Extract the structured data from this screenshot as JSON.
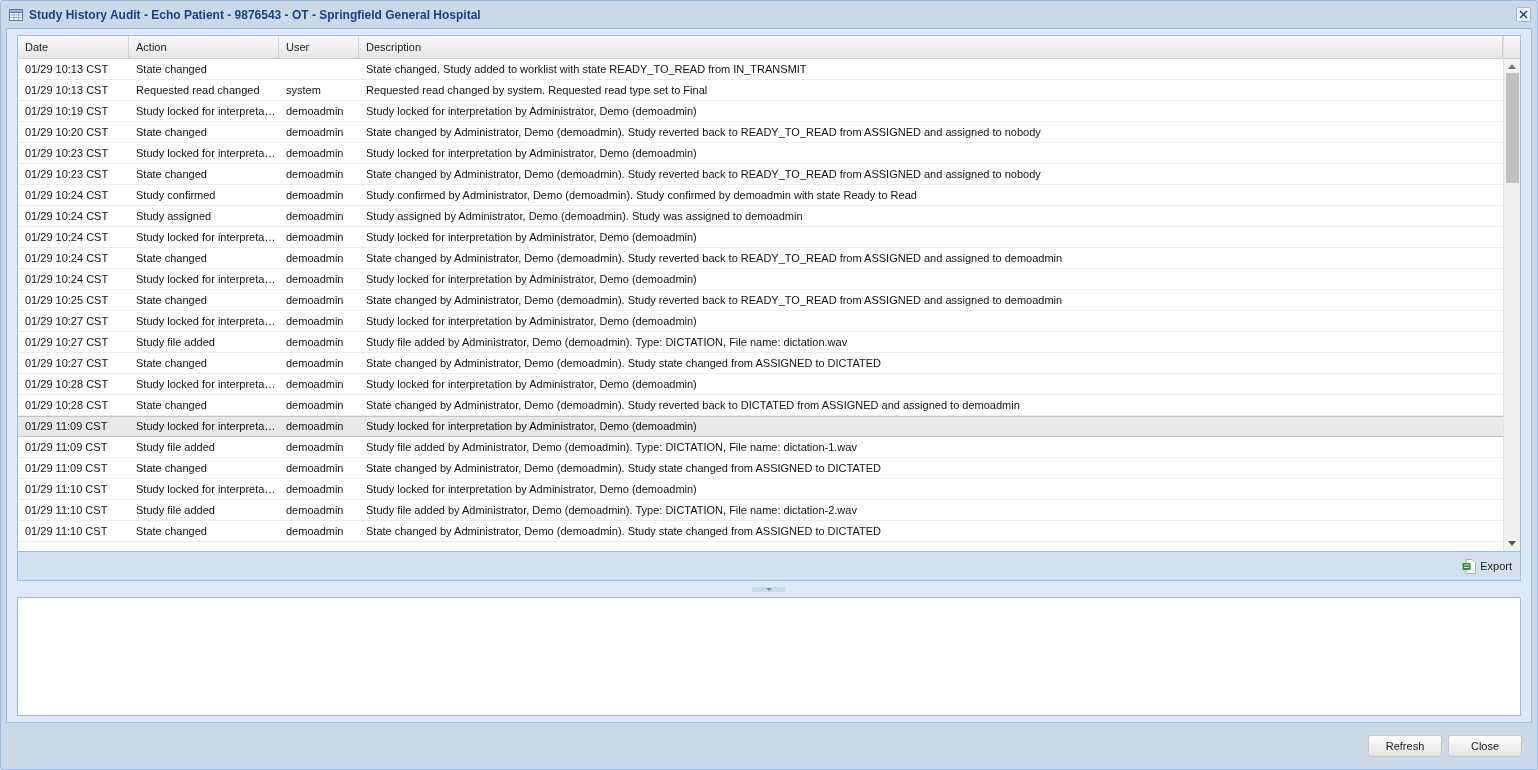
{
  "window": {
    "title": "Study History Audit - Echo Patient - 9876543 - OT - Springfield General Hospital"
  },
  "table": {
    "columns": [
      "Date",
      "Action",
      "User",
      "Description"
    ],
    "rows": [
      {
        "cells": [
          "01/29 10:13 CST",
          "State changed",
          "",
          "State changed. Study added to worklist with state READY_TO_READ from IN_TRANSMIT"
        ],
        "selected": false
      },
      {
        "cells": [
          "01/29 10:13 CST",
          "Requested read changed",
          "system",
          "Requested read changed by system. Requested read type set to Final"
        ],
        "selected": false
      },
      {
        "cells": [
          "01/29 10:19 CST",
          "Study locked for interpreta…",
          "demoadmin",
          "Study locked for interpretation by Administrator, Demo (demoadmin)"
        ],
        "selected": false
      },
      {
        "cells": [
          "01/29 10:20 CST",
          "State changed",
          "demoadmin",
          "State changed by Administrator, Demo (demoadmin). Study reverted back to READY_TO_READ from ASSIGNED and assigned to nobody"
        ],
        "selected": false
      },
      {
        "cells": [
          "01/29 10:23 CST",
          "Study locked for interpreta…",
          "demoadmin",
          "Study locked for interpretation by Administrator, Demo (demoadmin)"
        ],
        "selected": false
      },
      {
        "cells": [
          "01/29 10:23 CST",
          "State changed",
          "demoadmin",
          "State changed by Administrator, Demo (demoadmin). Study reverted back to READY_TO_READ from ASSIGNED and assigned to nobody"
        ],
        "selected": false
      },
      {
        "cells": [
          "01/29 10:24 CST",
          "Study confirmed",
          "demoadmin",
          "Study confirmed by Administrator, Demo (demoadmin). Study confirmed by demoadmin with state Ready to Read"
        ],
        "selected": false
      },
      {
        "cells": [
          "01/29 10:24 CST",
          "Study assigned",
          "demoadmin",
          "Study assigned by Administrator, Demo (demoadmin). Study was assigned to demoadmin"
        ],
        "selected": false
      },
      {
        "cells": [
          "01/29 10:24 CST",
          "Study locked for interpreta…",
          "demoadmin",
          "Study locked for interpretation by Administrator, Demo (demoadmin)"
        ],
        "selected": false
      },
      {
        "cells": [
          "01/29 10:24 CST",
          "State changed",
          "demoadmin",
          "State changed by Administrator, Demo (demoadmin). Study reverted back to READY_TO_READ from ASSIGNED and assigned to demoadmin"
        ],
        "selected": false
      },
      {
        "cells": [
          "01/29 10:24 CST",
          "Study locked for interpreta…",
          "demoadmin",
          "Study locked for interpretation by Administrator, Demo (demoadmin)"
        ],
        "selected": false
      },
      {
        "cells": [
          "01/29 10:25 CST",
          "State changed",
          "demoadmin",
          "State changed by Administrator, Demo (demoadmin). Study reverted back to READY_TO_READ from ASSIGNED and assigned to demoadmin"
        ],
        "selected": false
      },
      {
        "cells": [
          "01/29 10:27 CST",
          "Study locked for interpreta…",
          "demoadmin",
          "Study locked for interpretation by Administrator, Demo (demoadmin)"
        ],
        "selected": false
      },
      {
        "cells": [
          "01/29 10:27 CST",
          "Study file added",
          "demoadmin",
          "Study file added by Administrator, Demo (demoadmin). Type: DICTATION, File name: dictation.wav"
        ],
        "selected": false
      },
      {
        "cells": [
          "01/29 10:27 CST",
          "State changed",
          "demoadmin",
          "State changed by Administrator, Demo (demoadmin). Study state changed from ASSIGNED to DICTATED"
        ],
        "selected": false
      },
      {
        "cells": [
          "01/29 10:28 CST",
          "Study locked for interpreta…",
          "demoadmin",
          "Study locked for interpretation by Administrator, Demo (demoadmin)"
        ],
        "selected": false
      },
      {
        "cells": [
          "01/29 10:28 CST",
          "State changed",
          "demoadmin",
          "State changed by Administrator, Demo (demoadmin). Study reverted back to DICTATED from ASSIGNED and assigned to demoadmin"
        ],
        "selected": false
      },
      {
        "cells": [
          "01/29 11:09 CST",
          "Study locked for interpreta…",
          "demoadmin",
          "Study locked for interpretation by Administrator, Demo (demoadmin)"
        ],
        "selected": true
      },
      {
        "cells": [
          "01/29 11:09 CST",
          "Study file added",
          "demoadmin",
          "Study file added by Administrator, Demo (demoadmin). Type: DICTATION, File name: dictation-1.wav"
        ],
        "selected": false
      },
      {
        "cells": [
          "01/29 11:09 CST",
          "State changed",
          "demoadmin",
          "State changed by Administrator, Demo (demoadmin). Study state changed from ASSIGNED to DICTATED"
        ],
        "selected": false
      },
      {
        "cells": [
          "01/29 11:10 CST",
          "Study locked for interpreta…",
          "demoadmin",
          "Study locked for interpretation by Administrator, Demo (demoadmin)"
        ],
        "selected": false
      },
      {
        "cells": [
          "01/29 11:10 CST",
          "Study file added",
          "demoadmin",
          "Study file added by Administrator, Demo (demoadmin). Type: DICTATION, File name: dictation-2.wav"
        ],
        "selected": false
      },
      {
        "cells": [
          "01/29 11:10 CST",
          "State changed",
          "demoadmin",
          "State changed by Administrator, Demo (demoadmin). Study state changed from ASSIGNED to DICTATED"
        ],
        "selected": false
      }
    ]
  },
  "toolbar": {
    "export": "Export"
  },
  "buttons": [
    "Refresh",
    "Close"
  ]
}
